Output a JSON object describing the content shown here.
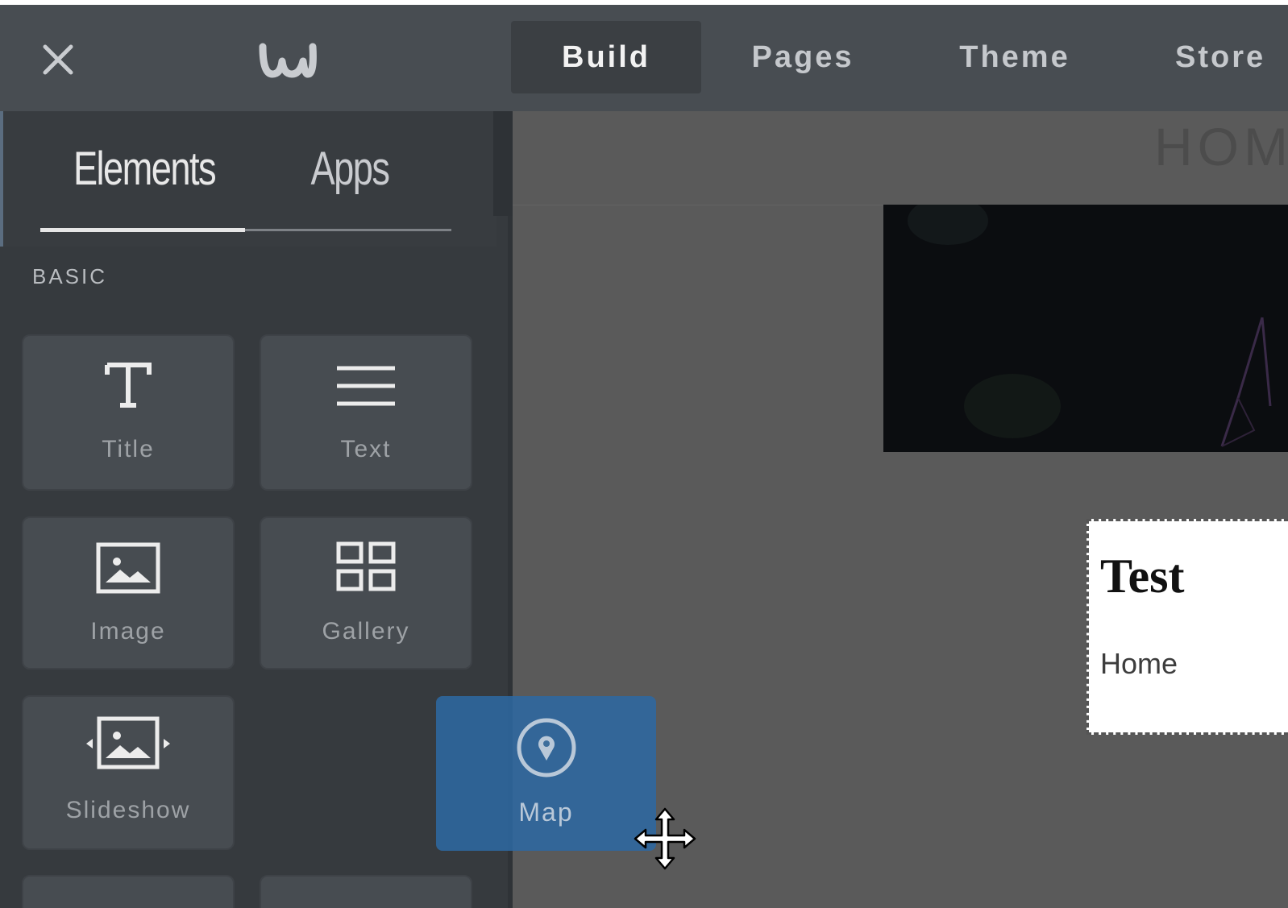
{
  "topbar": {
    "tabs": [
      {
        "label": "Build"
      },
      {
        "label": "Pages"
      },
      {
        "label": "Theme"
      },
      {
        "label": "Store"
      }
    ],
    "close_icon": "close-icon",
    "logo_icon": "weebly-logo"
  },
  "sidebar": {
    "tabs": [
      {
        "label": "Elements"
      },
      {
        "label": "Apps"
      }
    ],
    "section": "BASIC",
    "tiles": [
      {
        "label": "Title",
        "icon": "title-icon"
      },
      {
        "label": "Text",
        "icon": "text-icon"
      },
      {
        "label": "Image",
        "icon": "image-icon"
      },
      {
        "label": "Gallery",
        "icon": "gallery-icon"
      },
      {
        "label": "Slideshow",
        "icon": "slideshow-icon"
      }
    ]
  },
  "canvas": {
    "header_text": "HOM",
    "content_title": "Test",
    "content_text": "Home"
  },
  "drag": {
    "label": "Map",
    "icon": "map-pin-icon"
  },
  "colors": {
    "topbar_bg": "#484d52",
    "sidebar_bg": "#363a3e",
    "canvas_bg": "#5a5a5a",
    "drag_accent": "#2d68a0"
  }
}
